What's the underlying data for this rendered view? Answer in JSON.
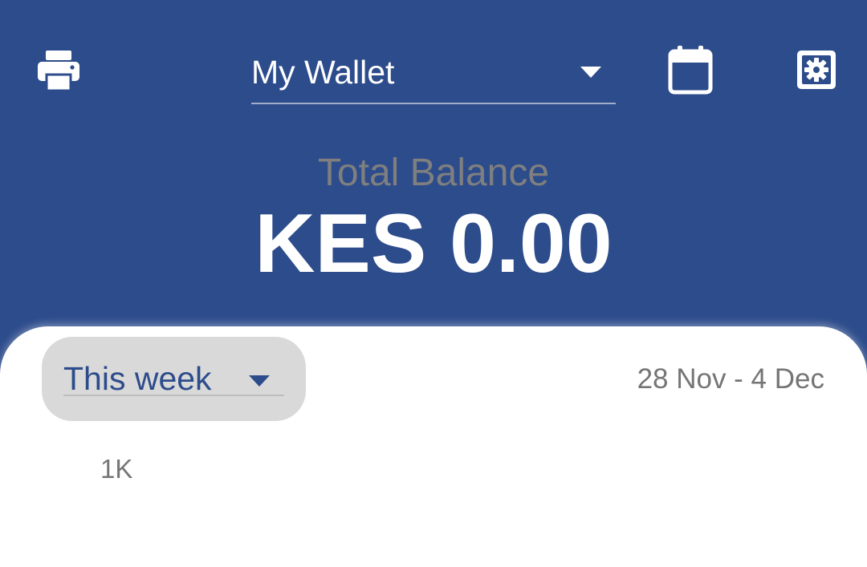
{
  "header": {
    "wallet_select": {
      "value": "My Wallet"
    },
    "balance_label": "Total Balance",
    "balance_amount": "KES 0.00",
    "icons": {
      "print": "print-icon",
      "calendar": "calendar-icon",
      "settings": "settings-icon"
    }
  },
  "card": {
    "period_select": {
      "value": "This week"
    },
    "date_range": "28 Nov - 4 Dec",
    "y_axis_tick": "1K"
  },
  "colors": {
    "primary": "#2d4c8b",
    "white": "#ffffff",
    "muted_text": "#757575",
    "chip_bg": "#d9d9d9"
  }
}
